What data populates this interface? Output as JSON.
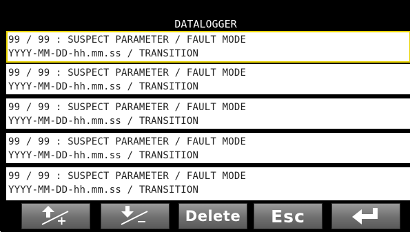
{
  "header": {
    "title": "DATALOGGER"
  },
  "entries": [
    {
      "line1": "99 / 99 : SUSPECT PARAMETER / FAULT MODE",
      "line2": "YYYY-MM-DD-hh.mm.ss / TRANSITION"
    },
    {
      "line1": "99 / 99 : SUSPECT PARAMETER / FAULT MODE",
      "line2": "YYYY-MM-DD-hh.mm.ss / TRANSITION"
    },
    {
      "line1": "99 / 99 : SUSPECT PARAMETER / FAULT MODE",
      "line2": "YYYY-MM-DD-hh.mm.ss / TRANSITION"
    },
    {
      "line1": "99 / 99 : SUSPECT PARAMETER / FAULT MODE",
      "line2": "YYYY-MM-DD-hh.mm.ss / TRANSITION"
    },
    {
      "line1": "99 / 99 : SUSPECT PARAMETER / FAULT MODE",
      "line2": "YYYY-MM-DD-hh.mm.ss / TRANSITION"
    }
  ],
  "toolbar": {
    "up_icon": "arrow-up-plus-icon",
    "down_icon": "arrow-down-minus-icon",
    "delete_label": "Delete",
    "esc_label": "Esc",
    "enter_icon": "enter-arrow-icon"
  },
  "colors": {
    "background": "#000000",
    "row_background": "#ffffff",
    "selected_border": "#e9d400",
    "button_gradient_top": "#9a9a9a",
    "button_gradient_bottom": "#5a5a5a"
  }
}
